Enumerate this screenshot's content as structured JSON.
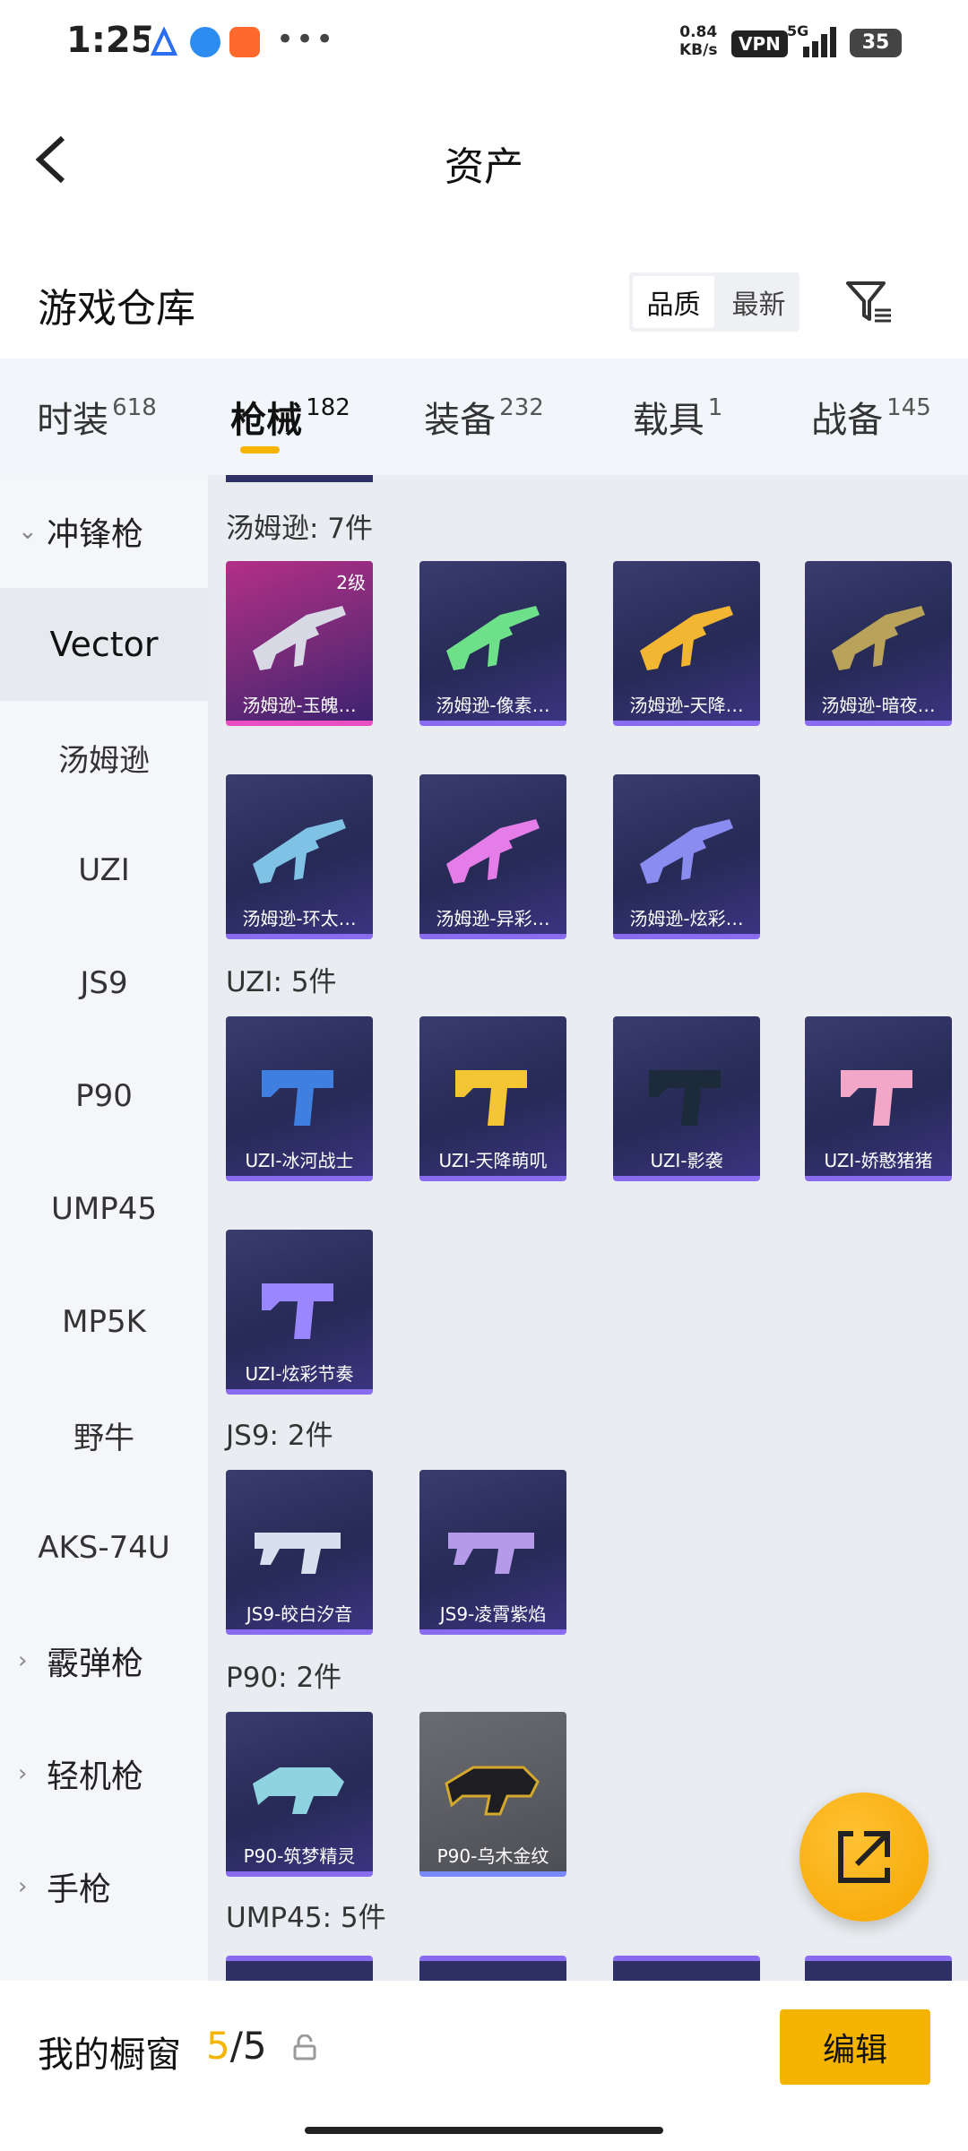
{
  "status": {
    "time": "1:25",
    "speed_value": "0.84",
    "speed_unit": "KB/s",
    "vpn": "VPN",
    "network": "5G",
    "battery": "35"
  },
  "header": {
    "title": "资产",
    "section_title": "游戏仓库",
    "sort_options": [
      "品质",
      "最新"
    ]
  },
  "tabs": [
    {
      "label": "时装",
      "count": "618"
    },
    {
      "label": "枪械",
      "count": "182"
    },
    {
      "label": "装备",
      "count": "232"
    },
    {
      "label": "载具",
      "count": "1"
    },
    {
      "label": "战备",
      "count": "145"
    }
  ],
  "sidebar": {
    "category_smg": "冲锋枪",
    "items": [
      "Vector",
      "汤姆逊",
      "UZI",
      "JS9",
      "P90",
      "UMP45",
      "MP5K",
      "野牛",
      "AKS-74U"
    ],
    "category_shotgun": "霰弹枪",
    "category_lmg": "轻机枪",
    "category_pistol": "手枪"
  },
  "groups": {
    "thompson": {
      "label": "汤姆逊: 7件",
      "items": [
        "汤姆逊-玉魄…",
        "汤姆逊-像素…",
        "汤姆逊-天降…",
        "汤姆逊-暗夜…",
        "汤姆逊-环太…",
        "汤姆逊-异彩…",
        "汤姆逊-炫彩…"
      ],
      "first_level": "2级"
    },
    "uzi": {
      "label": "UZI: 5件",
      "items": [
        "UZI-冰河战士",
        "UZI-天降萌叽",
        "UZI-影袭",
        "UZI-娇憨猪猪",
        "UZI-炫彩节奏"
      ]
    },
    "js9": {
      "label": "JS9: 2件",
      "items": [
        "JS9-皎白汐音",
        "JS9-凌霄紫焰"
      ]
    },
    "p90": {
      "label": "P90: 2件",
      "items": [
        "P90-筑梦精灵",
        "P90-乌木金纹"
      ]
    },
    "ump45": {
      "label": "UMP45: 5件"
    }
  },
  "bottom": {
    "showcase_label": "我的橱窗",
    "showcase_current": "5",
    "showcase_total": "/5",
    "edit_label": "编辑"
  },
  "colors": {
    "accent": "#f5b400",
    "rare_purple": "#8a6cf0",
    "legend_pink": "#e94fc1"
  }
}
